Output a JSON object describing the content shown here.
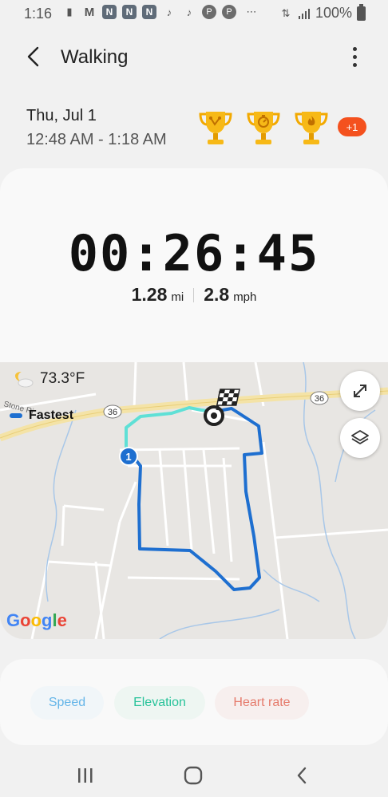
{
  "status_bar": {
    "time": "1:16",
    "battery": "100%",
    "icons": [
      "message-icon",
      "gmail-icon",
      "n-app-icon",
      "n-app-icon",
      "n-app-icon",
      "tiktok-icon",
      "tiktok-icon",
      "pinterest-icon",
      "pinterest-icon",
      "more-notifications-icon",
      "signal-icon",
      "battery-icon"
    ]
  },
  "header": {
    "title": "Walking"
  },
  "session": {
    "date": "Thu, Jul 1",
    "time_range": "12:48 AM - 1:18 AM",
    "extra_awards": "+1",
    "awards": [
      "trophy-route-icon",
      "trophy-stopwatch-icon",
      "trophy-flame-icon"
    ]
  },
  "summary": {
    "elapsed": "00:26:45",
    "distance_value": "1.28",
    "distance_unit": "mi",
    "speed_value": "2.8",
    "speed_unit": "mph"
  },
  "map": {
    "weather": "73.3°F",
    "legend_label": "Fastest",
    "route_marker": "1",
    "road_label": "36",
    "street_label": "Stone Ri",
    "logo": "Google"
  },
  "chips": {
    "speed": "Speed",
    "elevation": "Elevation",
    "heart_rate": "Heart rate"
  },
  "colors": {
    "route": "#1e6fd0",
    "fastest_segment": "#5fe0d6",
    "badge": "#f4511e"
  }
}
